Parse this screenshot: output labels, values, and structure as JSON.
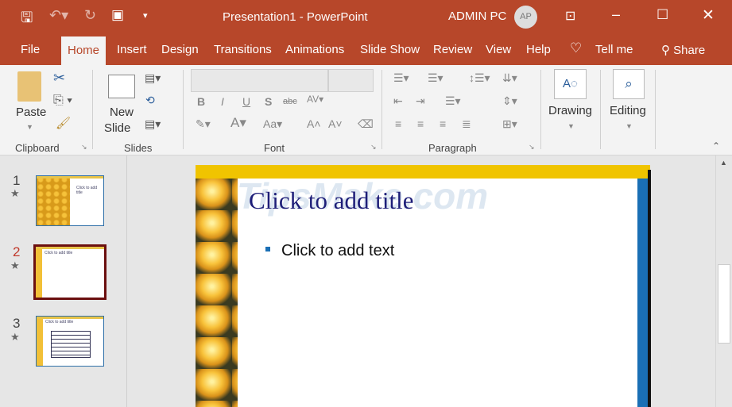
{
  "titlebar": {
    "title": "Presentation1  -  PowerPoint",
    "user": "ADMIN PC",
    "avatar": "AP"
  },
  "tabs": [
    "File",
    "Home",
    "Insert",
    "Design",
    "Transitions",
    "Animations",
    "Slide Show",
    "Review",
    "View",
    "Help"
  ],
  "tell_me": "Tell me",
  "share": "Share",
  "ribbon": {
    "paste": "Paste",
    "new": "New",
    "slide": "Slide",
    "drawing": "Drawing",
    "editing": "Editing",
    "groups": {
      "clipboard": "Clipboard",
      "slides": "Slides",
      "font": "Font",
      "paragraph": "Paragraph"
    }
  },
  "thumbnails": [
    {
      "num": "1",
      "title": "Click to add title"
    },
    {
      "num": "2",
      "title": "Click to add title"
    },
    {
      "num": "3",
      "title": "Click to add title"
    }
  ],
  "slide": {
    "title": "Click to add title",
    "bullet": "Click to add text"
  },
  "watermark": "TipsMake.com",
  "colors": {
    "accent": "#b7472a",
    "slide_blue": "#1a6fb5",
    "slide_yellow": "#f0c400"
  }
}
